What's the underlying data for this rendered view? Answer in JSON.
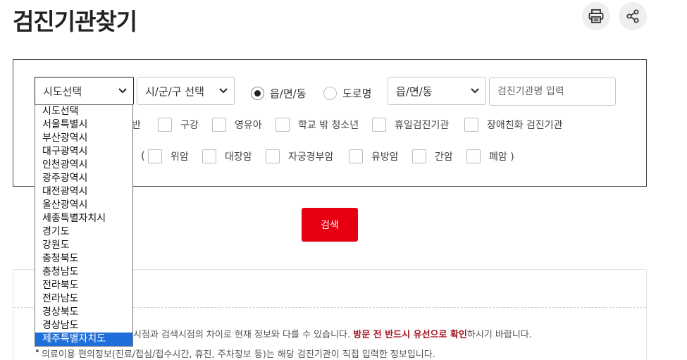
{
  "header": {
    "title": "검진기관찾기"
  },
  "filters": {
    "sido_select": "시도선택",
    "sigungu_select": "시/군/구 선택",
    "radio_eupmyeondong": "읍/면/동",
    "radio_doro": "도로명",
    "eupmyeondong_select": "읍/면/동",
    "name_placeholder": "검진기관명 입력",
    "row2": [
      "구강",
      "영유아",
      "학교 밖 청소년",
      "휴일검진기관",
      "장애친화 검진기관"
    ],
    "row2_partial": "반",
    "row3_open": "(",
    "row3": [
      "위암",
      "대장암",
      "자궁경부암",
      "유방암",
      "간암"
    ],
    "row3_last": "폐암 )"
  },
  "search_label": "검색",
  "notices": {
    "line1_pre": "시점과 검색시점의 차이로 현재 정보와 다를 수 있습니다.",
    "line1_emph": "방문 전 반드시 유선으로 확인",
    "line1_post": "하시기 바랍니다.",
    "line2": "의료이용 편의정보(진료/접심/접수시간, 휴진, 주차정보 등)는 해당 검진기관이 직접 입력한 정보입니다."
  },
  "dropdown_options": [
    "시도선택",
    "서울특별시",
    "부산광역시",
    "대구광역시",
    "인천광역시",
    "광주광역시",
    "대전광역시",
    "울산광역시",
    "세종특별자치시",
    "경기도",
    "강원도",
    "충청북도",
    "충청남도",
    "전라북도",
    "전라남도",
    "경상북도",
    "경상남도",
    "제주특별자치도"
  ],
  "dropdown_selected_index": 17,
  "colors": {
    "accent": "#e60012",
    "highlight": "#1e6fd9",
    "emphasis": "#a0111d"
  }
}
